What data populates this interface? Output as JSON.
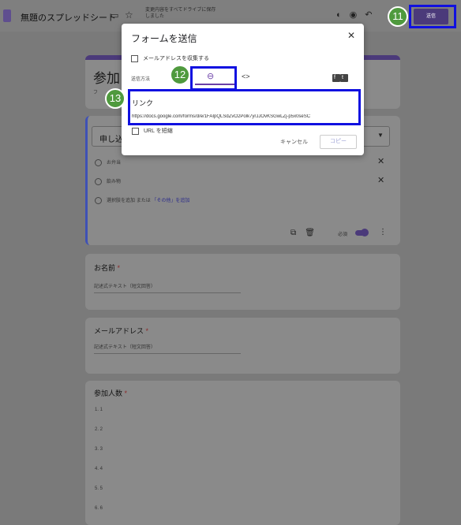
{
  "header": {
    "title": "無題のスプレッドシート",
    "folder_icon": "folder-icon",
    "star_icon": "star-icon",
    "save_status": "変更内容をすべてドライブに保存しました",
    "icons": [
      "palette-icon",
      "eye-icon",
      "undo-icon"
    ],
    "send_label": "送信"
  },
  "annotations": {
    "a11": "11",
    "a12": "12",
    "a13": "13"
  },
  "form": {
    "title": "参加",
    "subtitle": "フ"
  },
  "question_active": {
    "label": "申し込",
    "options": [
      "お弁当",
      "飲み物"
    ],
    "add_option": "選択肢を追加",
    "or": "または",
    "add_other": "「その他」を追加",
    "required_label": "必須"
  },
  "questions": [
    {
      "title": "お名前",
      "placeholder": "記述式テキスト（短文回答）"
    },
    {
      "title": "メールアドレス",
      "placeholder": "記述式テキスト（短文回答）"
    }
  ],
  "participants": {
    "title": "参加人数",
    "options": [
      "1. 1",
      "2. 2",
      "3. 3",
      "4. 4",
      "5. 5",
      "6. 6"
    ]
  },
  "modal": {
    "title": "フォームを送信",
    "collect_email": "メールアドレスを収集する",
    "send_method": "送信方法",
    "link_label": "リンク",
    "url": "https://docs.google.com/forms/d/e/1FAIpQLSdZvO2Polk7yrJJOvKSGwLZj-p5x0seSC",
    "shorten_url": "URL を短縮",
    "cancel": "キャンセル",
    "copy": "コピー"
  }
}
